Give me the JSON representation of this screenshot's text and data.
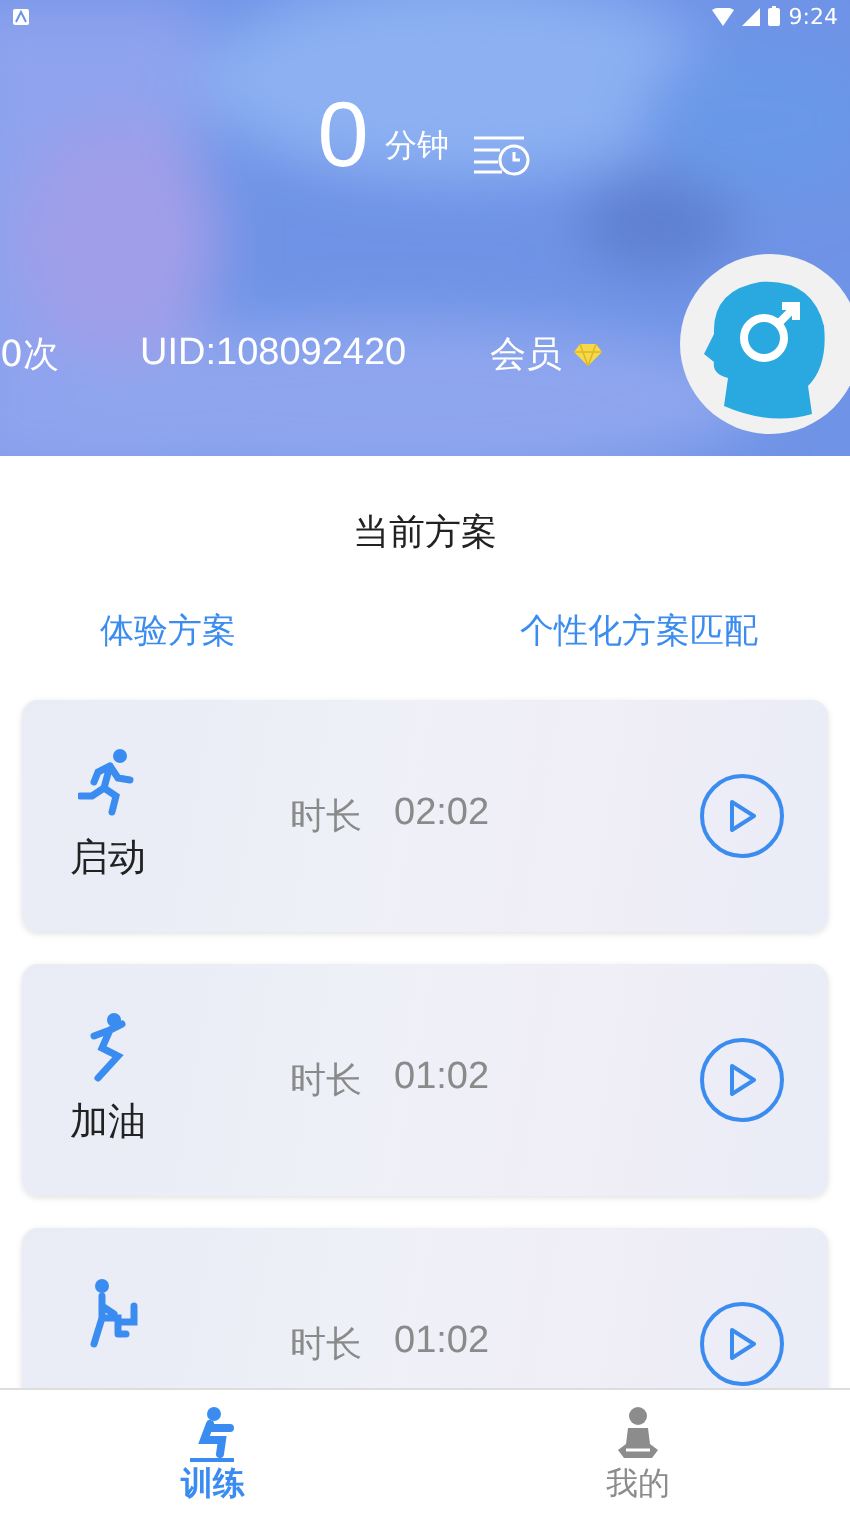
{
  "status_bar": {
    "time": "9:24"
  },
  "header": {
    "minutes": "0",
    "minutes_unit": "分钟",
    "count": "0次",
    "uid": "UID:108092420",
    "member": "会员"
  },
  "section_title": "当前方案",
  "plan_links": [
    "体验方案",
    "个性化方案匹配"
  ],
  "plans": [
    {
      "kind": "run",
      "name": "启动",
      "duration_label": "时长",
      "duration": "02:02"
    },
    {
      "kind": "jump",
      "name": "加油",
      "duration_label": "时长",
      "duration": "01:02"
    },
    {
      "kind": "climb",
      "duration_label": "时长",
      "duration": "01:02"
    }
  ],
  "bottom_nav": [
    {
      "kind": "train",
      "label": "训练",
      "selected": true
    },
    {
      "kind": "me",
      "label": "我的",
      "selected": false
    }
  ]
}
